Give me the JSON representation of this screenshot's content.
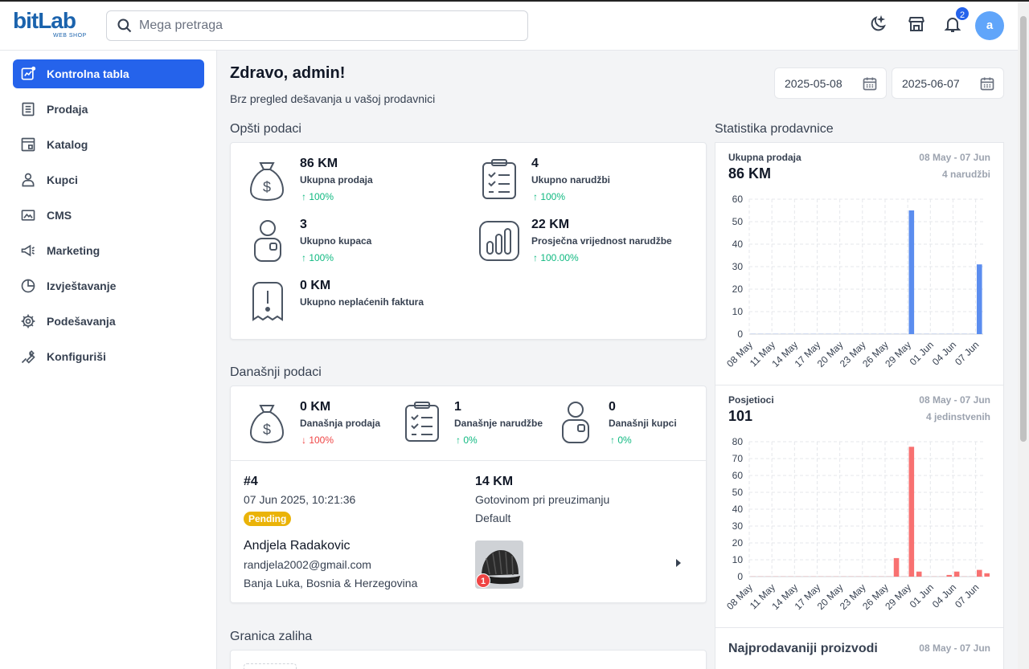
{
  "header": {
    "logo_text": "bitLab",
    "logo_sub": "WEB SHOP",
    "search_placeholder": "Mega pretraga",
    "notification_count": "2",
    "avatar_letter": "a",
    "icons": [
      "theme-toggle-icon",
      "store-icon",
      "bell-icon"
    ]
  },
  "sidebar": {
    "items": [
      {
        "label": "Kontrolna tabla",
        "icon": "dashboard-icon",
        "active": true
      },
      {
        "label": "Prodaja",
        "icon": "receipt-icon"
      },
      {
        "label": "Katalog",
        "icon": "catalog-icon"
      },
      {
        "label": "Kupci",
        "icon": "user-icon"
      },
      {
        "label": "CMS",
        "icon": "cms-icon"
      },
      {
        "label": "Marketing",
        "icon": "megaphone-icon"
      },
      {
        "label": "Izvještavanje",
        "icon": "pie-chart-icon"
      },
      {
        "label": "Podešavanja",
        "icon": "gear-icon"
      },
      {
        "label": "Konfiguriši",
        "icon": "wrench-icon"
      }
    ]
  },
  "main": {
    "greeting": "Zdravo, admin!",
    "subtitle": "Brz pregled dešavanja u vašoj prodavnici",
    "date_from": "2025-05-08",
    "date_to": "2025-06-07",
    "general": {
      "title": "Opšti podaci",
      "stats": [
        {
          "value": "86 KM",
          "label": "Ukupna prodaja",
          "change": "↑ 100%",
          "icon": "money-bag-icon"
        },
        {
          "value": "4",
          "label": "Ukupno narudžbi",
          "change": "↑ 100%",
          "icon": "clipboard-list-icon"
        },
        {
          "value": "3",
          "label": "Ukupno kupaca",
          "change": "↑ 100%",
          "icon": "customer-icon"
        },
        {
          "value": "22 KM",
          "label": "Prosječna vrijednost narudžbe",
          "change": "↑ 100.00%",
          "icon": "bar-stats-icon"
        },
        {
          "value": "0 KM",
          "label": "Ukupno neplaćenih faktura",
          "icon": "unpaid-invoice-icon"
        }
      ]
    },
    "today": {
      "title": "Današnji podaci",
      "stats": [
        {
          "value": "0 KM",
          "label": "Današnja prodaja",
          "change": "↓ 100%",
          "icon": "money-bag-icon"
        },
        {
          "value": "1",
          "label": "Današnje narudžbe",
          "change": "↑ 0%",
          "icon": "clipboard-list-icon"
        },
        {
          "value": "0",
          "label": "Današnji kupci",
          "change": "↑ 0%",
          "icon": "customer-icon"
        }
      ],
      "order": {
        "id": "#4",
        "date": "07 Jun 2025, 10:21:36",
        "status": "Pending",
        "total": "14 KM",
        "payment": "Gotovinom pri preuzimanju",
        "shipping": "Default",
        "customer_name": "Andjela Radakovic",
        "customer_email": "randjela2002@gmail.com",
        "customer_address": "Banja Luka, Bosnia & Herzegovina",
        "item_count": "1"
      }
    },
    "stock_title": "Granica zaliha"
  },
  "store_stats": {
    "title": "Statistika prodavnice",
    "sales": {
      "title": "Ukupna prodaja",
      "date_range": "08 May - 07 Jun",
      "value": "86 KM",
      "sub": "4 narudžbi"
    },
    "visitors": {
      "title": "Posjetioci",
      "date_range": "08 May - 07 Jun",
      "value": "101",
      "sub": "4 jedinstvenih"
    },
    "top_products": {
      "title": "Najprodavaniji proizvodi",
      "date_range": "08 May - 07 Jun"
    }
  },
  "chart_data": [
    {
      "type": "bar",
      "title": "Ukupna prodaja",
      "x_tick_labels": [
        "08 May",
        "11 May",
        "14 May",
        "17 May",
        "20 May",
        "23 May",
        "26 May",
        "29 May",
        "01 Jun",
        "04 Jun",
        "07 Jun"
      ],
      "x": [
        "08 May",
        "09 May",
        "10 May",
        "11 May",
        "12 May",
        "13 May",
        "14 May",
        "15 May",
        "16 May",
        "17 May",
        "18 May",
        "19 May",
        "20 May",
        "21 May",
        "22 May",
        "23 May",
        "24 May",
        "25 May",
        "26 May",
        "27 May",
        "28 May",
        "29 May",
        "30 May",
        "31 May",
        "01 Jun",
        "02 Jun",
        "03 Jun",
        "04 Jun",
        "05 Jun",
        "06 Jun",
        "07 Jun"
      ],
      "values": [
        0,
        0,
        0,
        0,
        0,
        0,
        0,
        0,
        0,
        0,
        0,
        0,
        0,
        0,
        0,
        0,
        0,
        0,
        0,
        0,
        0,
        55,
        0,
        0,
        0,
        0,
        0,
        0,
        0,
        0,
        31
      ],
      "ylim": [
        0,
        60
      ],
      "yticks": [
        0,
        10,
        20,
        30,
        40,
        50,
        60
      ],
      "color": "#5b8def",
      "grid": true
    },
    {
      "type": "bar",
      "title": "Posjetioci",
      "x_tick_labels": [
        "08 May",
        "11 May",
        "14 May",
        "17 May",
        "20 May",
        "23 May",
        "26 May",
        "29 May",
        "01 Jun",
        "04 Jun",
        "07 Jun"
      ],
      "x": [
        "08 May",
        "09 May",
        "10 May",
        "11 May",
        "12 May",
        "13 May",
        "14 May",
        "15 May",
        "16 May",
        "17 May",
        "18 May",
        "19 May",
        "20 May",
        "21 May",
        "22 May",
        "23 May",
        "24 May",
        "25 May",
        "26 May",
        "27 May",
        "28 May",
        "29 May",
        "30 May",
        "31 May",
        "01 Jun",
        "02 Jun",
        "03 Jun",
        "04 Jun",
        "05 Jun",
        "06 Jun",
        "07 Jun"
      ],
      "values": [
        0,
        0,
        0,
        0,
        0,
        0,
        0,
        0,
        0,
        0,
        0,
        0,
        0,
        0,
        0,
        0,
        0,
        0,
        0,
        11,
        0,
        77,
        3,
        0,
        0,
        0,
        1,
        3,
        0,
        0,
        4,
        2
      ],
      "ylim": [
        0,
        80
      ],
      "yticks": [
        0,
        10,
        20,
        30,
        40,
        50,
        60,
        70,
        80
      ],
      "color": "#f87171",
      "grid": true
    }
  ]
}
